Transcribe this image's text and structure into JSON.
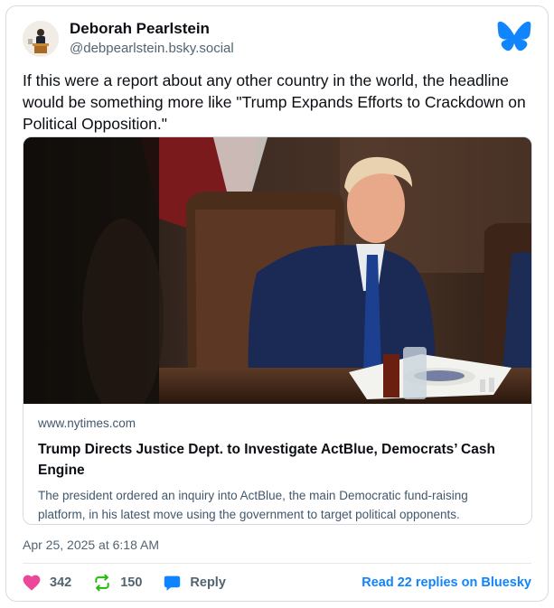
{
  "author": {
    "display_name": "Deborah Pearlstein",
    "handle": "@debpearlstein.bsky.social"
  },
  "post": {
    "text": "If this were a report about any other country in the world, the headline would be something more like \"Trump Expands Efforts to Crackdown on Political Opposition.\"",
    "timestamp": "Apr 25, 2025 at 6:18 AM"
  },
  "embed": {
    "domain": "www.nytimes.com",
    "title": "Trump Directs Justice Dept. to Investigate ActBlue, Democrats’ Cash Engine",
    "description": "The president ordered an inquiry into ActBlue, the main Democratic fund-raising platform, in his latest move using the government to target political opponents."
  },
  "stats": {
    "likes": "342",
    "reposts": "150",
    "reply_label": "Reply",
    "read_replies": "Read 22 replies on Bluesky"
  },
  "icons": {
    "logo": "bluesky-butterfly-icon",
    "like": "heart-icon",
    "repost": "repost-icon",
    "reply": "speech-bubble-icon"
  },
  "colors": {
    "brand": "#1083fe",
    "like": "#ec4899",
    "repost": "#20bc07",
    "reply": "#1083fe"
  }
}
